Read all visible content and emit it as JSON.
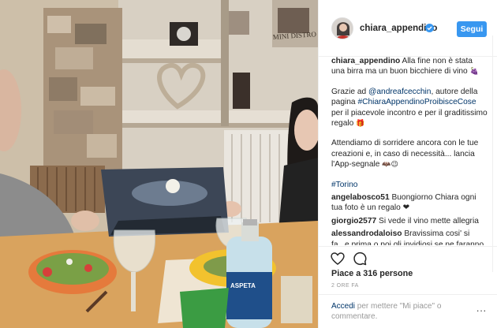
{
  "post": {
    "username": "chiara_appendino",
    "verified_icon": "verified-badge-icon",
    "follow_label": "Segui",
    "accent_color": "#3897f0"
  },
  "caption": {
    "author": "chiara_appendino",
    "text1": "Alla fine non è stata una birra ma un buon bicchiere di vino",
    "text1_emoji": "🍇",
    "grazie_prefix": "Grazie ad",
    "mention": "@andreafcecchin",
    "grazie_mid": ", autore della pagina",
    "hashtag1": "#ChiaraAppendinoProibisceCose",
    "grazie_suffix": "per il piacevole incontro e per il graditissimo regalo",
    "grazie_emoji": "🎁",
    "attendiamo": "Attendiamo di sorridere ancora con le tue creazioni e, in caso di necessità... lancia l'App-segnale",
    "attendiamo_emoji": "🦇😉",
    "hashtag2": "#Torino"
  },
  "comments": [
    {
      "user": "angelabosco51",
      "text": "Buongiorno Chiara ogni tua foto è un regalo ❤"
    },
    {
      "user": "giorgio2577",
      "text": "Si vede il vino mette allegria"
    },
    {
      "user": "alessandrodaloiso",
      "text": "Bravissima cosi' si fa...e prima o poi gli invidiosi se ne faranno una ragione"
    }
  ],
  "actions": {
    "like_icon": "heart-icon",
    "comment_icon": "comment-icon",
    "likes_text": "Piace a 316 persone",
    "time_text": "2 ORE FA"
  },
  "add_comment": {
    "accedi": "Accedi",
    "rest": "per mettere \"Mi piace\" o commentare.",
    "more": "..."
  },
  "photo": {
    "wall_sign": "MINI DISTRO",
    "bottle_label": "ASPETA"
  }
}
